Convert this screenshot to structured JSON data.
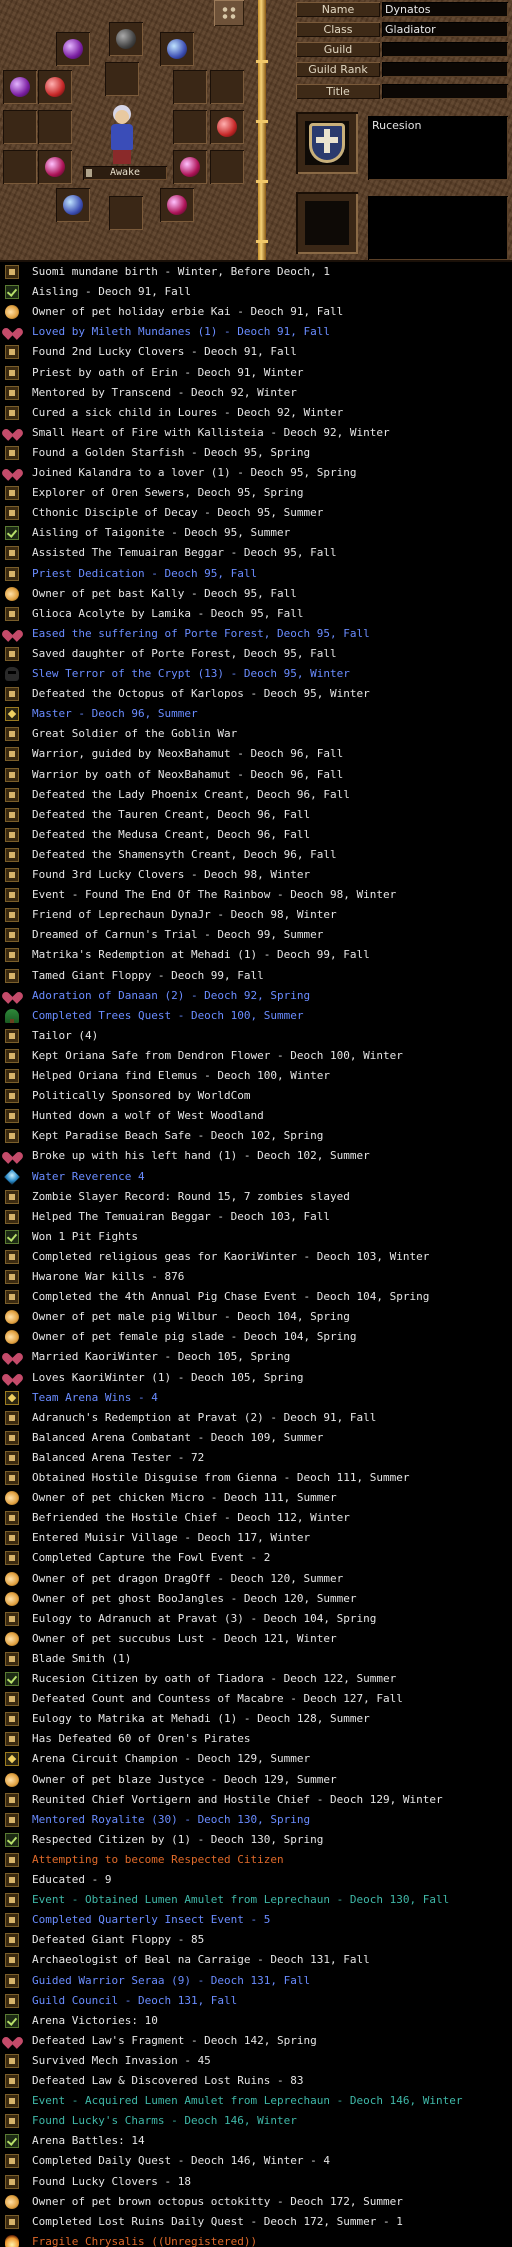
{
  "character": {
    "fields": [
      {
        "label": "Name",
        "value": "Dynatos"
      },
      {
        "label": "Class",
        "value": "Gladiator"
      },
      {
        "label": "Guild",
        "value": ""
      },
      {
        "label": "Guild Rank",
        "value": ""
      },
      {
        "label": "Title",
        "value": ""
      }
    ],
    "state_label": "Awake",
    "nation": "Rucesion",
    "info_box_2": ""
  },
  "legend": [
    {
      "icon": "mark",
      "color": "#e6e6e6",
      "text": "Suomi mundane birth - Winter, Before Deoch, 1"
    },
    {
      "icon": "check",
      "color": "#e6e6e6",
      "text": "Aisling - Deoch 91, Fall"
    },
    {
      "icon": "fish",
      "color": "#e6e6e6",
      "text": "Owner of pet holiday erbie Kai - Deoch 91, Fall"
    },
    {
      "icon": "heart",
      "color": "#6a8cff",
      "text": "Loved by Mileth Mundanes (1) - Deoch 91, Fall"
    },
    {
      "icon": "mark",
      "color": "#e6e6e6",
      "text": "Found 2nd Lucky Clovers - Deoch 91, Fall"
    },
    {
      "icon": "mark",
      "color": "#e6e6e6",
      "text": "Priest by oath of Erin - Deoch 91, Winter"
    },
    {
      "icon": "mark",
      "color": "#e6e6e6",
      "text": "Mentored by Transcend - Deoch 92, Winter"
    },
    {
      "icon": "mark",
      "color": "#e6e6e6",
      "text": "Cured a sick child in Loures - Deoch 92, Winter"
    },
    {
      "icon": "heart",
      "color": "#e6e6e6",
      "text": "Small Heart of Fire with Kallisteia - Deoch 92, Winter"
    },
    {
      "icon": "mark",
      "color": "#e6e6e6",
      "text": "Found a Golden Starfish - Deoch 95, Spring"
    },
    {
      "icon": "heart",
      "color": "#e6e6e6",
      "text": "Joined Kalandra to a lover (1) - Deoch 95, Spring"
    },
    {
      "icon": "mark",
      "color": "#e6e6e6",
      "text": "Explorer of Oren Sewers, Deoch 95, Spring"
    },
    {
      "icon": "mark",
      "color": "#e6e6e6",
      "text": "Cthonic Disciple of Decay - Deoch 95, Summer"
    },
    {
      "icon": "check",
      "color": "#e6e6e6",
      "text": "Aisling of Taigonite - Deoch 95, Summer"
    },
    {
      "icon": "mark",
      "color": "#e6e6e6",
      "text": "Assisted The Temuairan Beggar - Deoch 95, Fall"
    },
    {
      "icon": "mark",
      "color": "#6a8cff",
      "text": "Priest Dedication - Deoch 95, Fall"
    },
    {
      "icon": "fish",
      "color": "#e6e6e6",
      "text": "Owner of pet bast Kally - Deoch 95, Fall"
    },
    {
      "icon": "mark",
      "color": "#e6e6e6",
      "text": "Glioca Acolyte by Lamika - Deoch 95, Fall"
    },
    {
      "icon": "heart",
      "color": "#6a8cff",
      "text": "Eased the suffering of Porte Forest, Deoch 95, Fall"
    },
    {
      "icon": "mark",
      "color": "#e6e6e6",
      "text": "Saved daughter of Porte Forest, Deoch 95, Fall"
    },
    {
      "icon": "skull",
      "color": "#6a8cff",
      "text": "Slew Terror of the Crypt (13) - Deoch 95, Winter"
    },
    {
      "icon": "mark",
      "color": "#e6e6e6",
      "text": "Defeated the Octopus of Karlopos - Deoch 95, Winter"
    },
    {
      "icon": "star",
      "color": "#6a8cff",
      "text": "Master - Deoch 96, Summer"
    },
    {
      "icon": "mark",
      "color": "#e6e6e6",
      "text": "Great Soldier of the Goblin War"
    },
    {
      "icon": "mark",
      "color": "#e6e6e6",
      "text": "Warrior, guided by NeoxBahamut - Deoch 96, Fall"
    },
    {
      "icon": "mark",
      "color": "#e6e6e6",
      "text": "Warrior by oath of NeoxBahamut - Deoch 96, Fall"
    },
    {
      "icon": "mark",
      "color": "#e6e6e6",
      "text": "Defeated the Lady Phoenix Creant, Deoch 96, Fall"
    },
    {
      "icon": "mark",
      "color": "#e6e6e6",
      "text": "Defeated the Tauren Creant, Deoch 96, Fall"
    },
    {
      "icon": "mark",
      "color": "#e6e6e6",
      "text": "Defeated the Medusa Creant, Deoch 96, Fall"
    },
    {
      "icon": "mark",
      "color": "#e6e6e6",
      "text": "Defeated the Shamensyth Creant, Deoch 96, Fall"
    },
    {
      "icon": "mark",
      "color": "#e6e6e6",
      "text": "Found 3rd Lucky Clovers - Deoch 98, Winter"
    },
    {
      "icon": "mark",
      "color": "#e6e6e6",
      "text": "Event - Found The End Of The Rainbow - Deoch 98, Winter"
    },
    {
      "icon": "mark",
      "color": "#e6e6e6",
      "text": "Friend of Leprechaun DynaJr - Deoch 98, Winter"
    },
    {
      "icon": "mark",
      "color": "#e6e6e6",
      "text": "Dreamed of Carnun's Trial - Deoch 99, Summer"
    },
    {
      "icon": "mark",
      "color": "#e6e6e6",
      "text": "Matrika's Redemption at Mehadi (1) - Deoch 99, Fall"
    },
    {
      "icon": "mark",
      "color": "#e6e6e6",
      "text": "Tamed Giant Floppy - Deoch 99, Fall"
    },
    {
      "icon": "heart",
      "color": "#6a8cff",
      "text": "Adoration of Danaan (2) - Deoch 92, Spring"
    },
    {
      "icon": "tree",
      "color": "#6a8cff",
      "text": "Completed Trees Quest - Deoch 100, Summer"
    },
    {
      "icon": "mark",
      "color": "#e6e6e6",
      "text": "Tailor (4)"
    },
    {
      "icon": "mark",
      "color": "#e6e6e6",
      "text": "Kept Oriana Safe from Dendron Flower - Deoch 100, Winter"
    },
    {
      "icon": "mark",
      "color": "#e6e6e6",
      "text": "Helped Oriana find Elemus - Deoch 100, Winter"
    },
    {
      "icon": "mark",
      "color": "#e6e6e6",
      "text": "Politically Sponsored by WorldCom"
    },
    {
      "icon": "mark",
      "color": "#e6e6e6",
      "text": "Hunted down a wolf of West Woodland"
    },
    {
      "icon": "mark",
      "color": "#e6e6e6",
      "text": "Kept Paradise Beach Safe - Deoch 102, Spring"
    },
    {
      "icon": "heart",
      "color": "#e6e6e6",
      "text": "Broke up with his left hand (1) - Deoch 102, Summer"
    },
    {
      "icon": "gem",
      "color": "#6a8cff",
      "text": "Water Reverence 4"
    },
    {
      "icon": "mark",
      "color": "#e6e6e6",
      "text": "Zombie Slayer Record: Round 15, 7 zombies slayed"
    },
    {
      "icon": "mark",
      "color": "#e6e6e6",
      "text": "Helped The Temuairan Beggar - Deoch 103, Fall"
    },
    {
      "icon": "check",
      "color": "#e6e6e6",
      "text": "Won 1 Pit Fights"
    },
    {
      "icon": "mark",
      "color": "#e6e6e6",
      "text": "Completed religious geas for KaoriWinter - Deoch 103, Winter"
    },
    {
      "icon": "mark",
      "color": "#e6e6e6",
      "text": "Hwarone War kills - 876"
    },
    {
      "icon": "mark",
      "color": "#e6e6e6",
      "text": "Completed the 4th Annual Pig Chase Event - Deoch 104, Spring"
    },
    {
      "icon": "fish",
      "color": "#e6e6e6",
      "text": "Owner of pet male pig Wilbur - Deoch 104, Spring"
    },
    {
      "icon": "fish",
      "color": "#e6e6e6",
      "text": "Owner of pet female pig slade - Deoch 104, Spring"
    },
    {
      "icon": "heart",
      "color": "#e6e6e6",
      "text": "Married KaoriWinter - Deoch 105, Spring"
    },
    {
      "icon": "heart",
      "color": "#e6e6e6",
      "text": "Loves KaoriWinter (1) - Deoch 105, Spring"
    },
    {
      "icon": "star",
      "color": "#6a8cff",
      "text": "Team Arena Wins - 4"
    },
    {
      "icon": "mark",
      "color": "#e6e6e6",
      "text": "Adranuch's Redemption at Pravat (2) - Deoch 91, Fall"
    },
    {
      "icon": "mark",
      "color": "#e6e6e6",
      "text": "Balanced Arena Combatant - Deoch 109, Summer"
    },
    {
      "icon": "mark",
      "color": "#e6e6e6",
      "text": "Balanced Arena Tester - 72"
    },
    {
      "icon": "mark",
      "color": "#e6e6e6",
      "text": "Obtained Hostile Disguise from Gienna - Deoch 111, Summer"
    },
    {
      "icon": "fish",
      "color": "#e6e6e6",
      "text": "Owner of pet chicken Micro - Deoch 111, Summer"
    },
    {
      "icon": "mark",
      "color": "#e6e6e6",
      "text": "Befriended the Hostile Chief - Deoch 112, Winter"
    },
    {
      "icon": "mark",
      "color": "#e6e6e6",
      "text": "Entered Muisir Village - Deoch 117, Winter"
    },
    {
      "icon": "mark",
      "color": "#e6e6e6",
      "text": "Completed Capture the Fowl Event - 2"
    },
    {
      "icon": "fish",
      "color": "#e6e6e6",
      "text": "Owner of pet dragon DragOff - Deoch 120, Summer"
    },
    {
      "icon": "fish",
      "color": "#e6e6e6",
      "text": "Owner of pet ghost BooJangles - Deoch 120, Summer"
    },
    {
      "icon": "mark",
      "color": "#e6e6e6",
      "text": "Eulogy to Adranuch at Pravat (3) - Deoch 104, Spring"
    },
    {
      "icon": "fish",
      "color": "#e6e6e6",
      "text": "Owner of pet succubus Lust - Deoch 121, Winter"
    },
    {
      "icon": "mark",
      "color": "#e6e6e6",
      "text": "Blade Smith (1)"
    },
    {
      "icon": "check",
      "color": "#e6e6e6",
      "text": "Rucesion Citizen by oath of Tiadora - Deoch 122, Summer"
    },
    {
      "icon": "mark",
      "color": "#e6e6e6",
      "text": "Defeated Count and Countess of Macabre - Deoch 127, Fall"
    },
    {
      "icon": "mark",
      "color": "#e6e6e6",
      "text": "Eulogy to Matrika at Mehadi (1) - Deoch 128, Summer"
    },
    {
      "icon": "mark",
      "color": "#e6e6e6",
      "text": "Has Defeated 60 of Oren's Pirates"
    },
    {
      "icon": "star",
      "color": "#e6e6e6",
      "text": "Arena Circuit Champion - Deoch 129, Summer"
    },
    {
      "icon": "fish",
      "color": "#e6e6e6",
      "text": "Owner of pet blaze Justyce - Deoch 129, Summer"
    },
    {
      "icon": "mark",
      "color": "#e6e6e6",
      "text": "Reunited Chief Vortigern and Hostile Chief - Deoch 129, Winter"
    },
    {
      "icon": "mark",
      "color": "#6a8cff",
      "text": "Mentored Royalite (30) - Deoch 130, Spring"
    },
    {
      "icon": "check",
      "color": "#e6e6e6",
      "text": "Respected Citizen by  (1) - Deoch 130, Spring"
    },
    {
      "icon": "mark",
      "color": "#e06a2a",
      "text": "Attempting to become Respected Citizen"
    },
    {
      "icon": "mark",
      "color": "#e6e6e6",
      "text": "Educated - 9"
    },
    {
      "icon": "mark",
      "color": "#3fb8a8",
      "text": "Event - Obtained Lumen Amulet from Leprechaun - Deoch 130, Fall"
    },
    {
      "icon": "mark",
      "color": "#6a8cff",
      "text": "Completed Quarterly Insect Event - 5"
    },
    {
      "icon": "mark",
      "color": "#e6e6e6",
      "text": "Defeated Giant Floppy - 85"
    },
    {
      "icon": "mark",
      "color": "#e6e6e6",
      "text": "Archaeologist of Beal na Carraige - Deoch 131, Fall"
    },
    {
      "icon": "mark",
      "color": "#6a8cff",
      "text": "Guided Warrior Seraa (9) - Deoch 131, Fall"
    },
    {
      "icon": "mark",
      "color": "#6a8cff",
      "text": "Guild Council - Deoch 131, Fall"
    },
    {
      "icon": "check",
      "color": "#e6e6e6",
      "text": "Arena Victories: 10"
    },
    {
      "icon": "heart",
      "color": "#e6e6e6",
      "text": "Defeated Law's Fragment - Deoch 142, Spring"
    },
    {
      "icon": "mark",
      "color": "#e6e6e6",
      "text": "Survived Mech Invasion - 45"
    },
    {
      "icon": "mark",
      "color": "#e6e6e6",
      "text": "Defeated Law & Discovered Lost Ruins - 83"
    },
    {
      "icon": "mark",
      "color": "#3fb8a8",
      "text": "Event - Acquired Lumen Amulet from Leprechaun - Deoch 146, Winter"
    },
    {
      "icon": "mark",
      "color": "#3fb8a8",
      "text": "Found Lucky's Charms - Deoch 146, Winter"
    },
    {
      "icon": "check",
      "color": "#e6e6e6",
      "text": "Arena Battles: 14"
    },
    {
      "icon": "mark",
      "color": "#e6e6e6",
      "text": "Completed Daily Quest - Deoch 146, Winter - 4"
    },
    {
      "icon": "mark",
      "color": "#e6e6e6",
      "text": "Found Lucky Clovers - 18"
    },
    {
      "icon": "fish",
      "color": "#e6e6e6",
      "text": "Owner of pet brown octopus octokitty - Deoch 172, Summer"
    },
    {
      "icon": "mark",
      "color": "#e6e6e6",
      "text": "Completed Lost Ruins Daily Quest - Deoch 172, Summer - 1"
    },
    {
      "icon": "flame",
      "color": "#e06a2a",
      "text": "Fragile Chrysalis ((Unregistered))"
    }
  ]
}
